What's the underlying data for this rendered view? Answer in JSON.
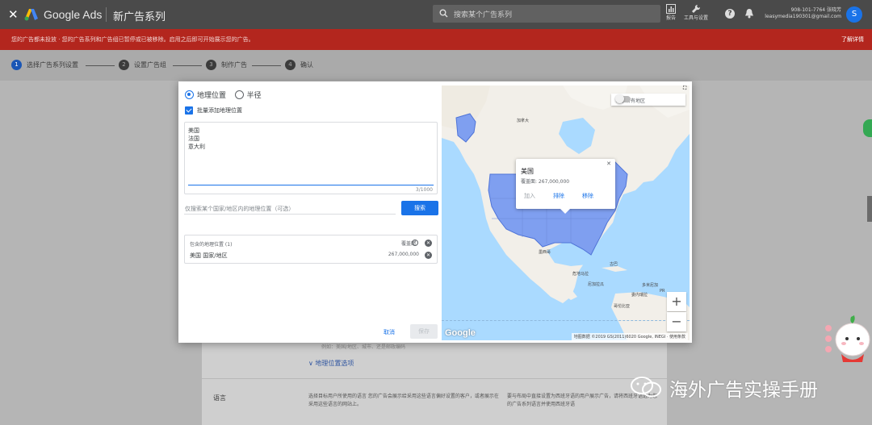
{
  "topbar": {
    "close_glyph": "✕",
    "brand": "Google Ads",
    "campaign_title": "新广告系列",
    "search_placeholder": "搜索某个广告系列",
    "reports_label": "报告",
    "tools_label": "工具与设置",
    "account_id": "908-101-7764 张晓芳",
    "account_email": "leasymedia190301@gmail.com",
    "avatar_initial": "S"
  },
  "banner": {
    "message": "您的广告都未投放 · 您的广告系列和广告组已暂停或已被移除。启用之后即可开始展示您的广告。",
    "learn_more": "了解详情"
  },
  "stepper": {
    "steps": [
      {
        "num": "1",
        "label": "选择广告系列设置"
      },
      {
        "num": "2",
        "label": "设置广告组"
      },
      {
        "num": "3",
        "label": "制作广告"
      },
      {
        "num": "4",
        "label": "确认"
      }
    ]
  },
  "dialog": {
    "radio_location": "地理位置",
    "radio_radius": "半径",
    "bulk_add_label": "批量添加地理位置",
    "textarea_lines": "美国\n法国\n意大利",
    "counter": "3/1000",
    "search_placeholder": "仅搜索某个国家/地区内的地理位置（可选）",
    "search_button": "搜索",
    "included_header": "包含的地理位置 (1)",
    "reach_label": "覆盖面",
    "included_row": "美国 国家/地区",
    "included_reach": "267,000,000",
    "cancel": "取消",
    "save": "保存"
  },
  "map": {
    "show_all_label": "显示所有地区",
    "popup": {
      "country": "美国",
      "reach": "覆盖面: 267,000,000",
      "add": "加入",
      "exclude": "排除",
      "remove": "移除"
    },
    "labels": {
      "canada": "加拿大",
      "mexico": "墨西哥",
      "cuba": "古巴",
      "venezuela": "委内瑞拉",
      "colombia": "哥伦比亚",
      "guatemala": "危地马拉",
      "nicaragua": "尼加拉瓜",
      "dominican": "多米尼加",
      "pr": "PR"
    },
    "zoom_in": "+",
    "zoom_out": "−",
    "google": "Google",
    "attribution": "地图数据 ©2019 GS(2011)6020 Google, INEGI · 使用条款"
  },
  "background": {
    "hint": "例如：美国/地区、城市、还是邮政编码",
    "location_options": "∨ 地理位置选项",
    "language_title": "语言",
    "language_desc": "选择目标用户所使用的语言\n您的广告会展示给采用这些语言偏好设置的客户，或者展示在采用这些语言的网站上。",
    "language_side": "要与布局中直接设置为西班牙语的用户展示广告，请将西班牙语选为您的广告系列语言并使用西班牙语"
  },
  "watermark": "海外广告实操手册",
  "colors": {
    "accent": "#1a73e8",
    "banner": "#b3261e",
    "topbar": "#4a4a4a",
    "map_water": "#aadaff",
    "map_land": "#f2efe9",
    "usa_fill": "#7f9ff0"
  }
}
